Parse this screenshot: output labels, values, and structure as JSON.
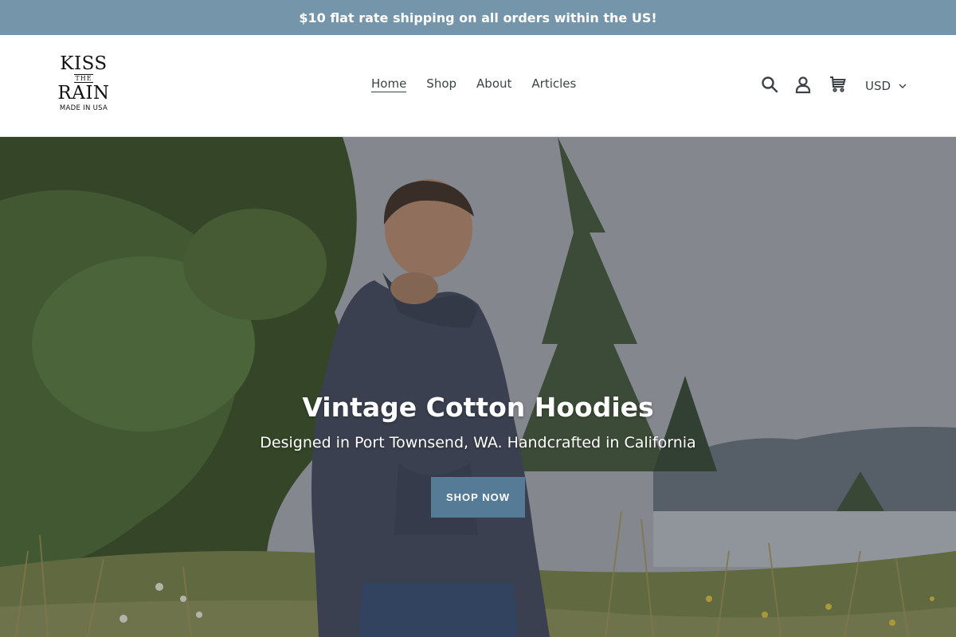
{
  "announcement": {
    "text": "$10 flat rate shipping on all orders within the US!"
  },
  "brand": {
    "logo_lines": {
      "top": "KISS",
      "middle": "THE",
      "bottom": "RAIN",
      "tagline": "MADE IN USA"
    }
  },
  "nav": {
    "items": [
      {
        "label": "Home",
        "active": true
      },
      {
        "label": "Shop",
        "active": false
      },
      {
        "label": "About",
        "active": false
      },
      {
        "label": "Articles",
        "active": false
      }
    ]
  },
  "header_icons": [
    "search-icon",
    "account-icon",
    "cart-icon"
  ],
  "currency": {
    "selected": "USD"
  },
  "hero": {
    "title": "Vintage Cotton Hoodies",
    "subtitle": "Designed in Port Townsend, WA. Handcrafted in California",
    "button_label": "SHOP NOW"
  },
  "colors": {
    "announcement_bg": "#7595ab",
    "button_bg": "#557b97",
    "text": "#3d4246"
  }
}
